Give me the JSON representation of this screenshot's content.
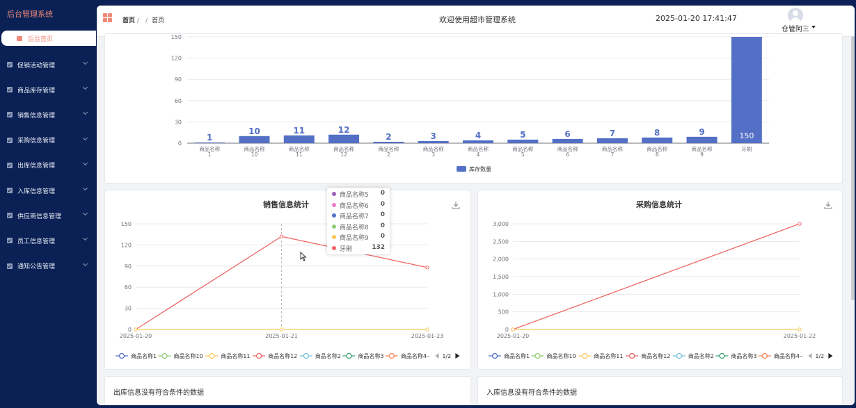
{
  "sidebar": {
    "logo": "后台管理系统",
    "active_item": "后台首页",
    "items": [
      {
        "label": "促销活动管理"
      },
      {
        "label": "商品库存管理"
      },
      {
        "label": "销售信息管理"
      },
      {
        "label": "采购信息管理"
      },
      {
        "label": "出库信息管理"
      },
      {
        "label": "入库信息管理"
      },
      {
        "label": "供应商信息管理"
      },
      {
        "label": "员工信息管理"
      },
      {
        "label": "通知公告管理"
      }
    ]
  },
  "header": {
    "breadcrumb_home": "首页",
    "breadcrumb_sep1": "/",
    "breadcrumb_sep2": "/",
    "breadcrumb_current": "首页",
    "title": "欢迎使用超市管理系统",
    "datetime": "2025-01-20 17:41:47",
    "user": "仓管阿三"
  },
  "colors": {
    "accent": "#f08a78",
    "bar": "#5470c6",
    "sidebar": "#0b2155"
  },
  "icons": [
    "grid-menu-icon",
    "home-icon",
    "checkbox-icon",
    "chevron-down-icon",
    "download-icon",
    "avatar-icon",
    "pointer-cursor-icon"
  ],
  "chart_data": [
    {
      "type": "bar",
      "title": "",
      "categories": [
        "商品名称\n1",
        "商品名称\n10",
        "商品名称\n11",
        "商品名称\n12",
        "商品名称\n2",
        "商品名称\n3",
        "商品名称\n4",
        "商品名称\n5",
        "商品名称\n6",
        "商品名称\n7",
        "商品名称\n8",
        "商品名称\n9",
        "牙刷"
      ],
      "series": [
        {
          "name": "库存数量",
          "values": [
            1,
            10,
            11,
            12,
            2,
            3,
            4,
            5,
            6,
            7,
            8,
            9,
            150
          ]
        }
      ],
      "yticks": [
        "0",
        "30",
        "60",
        "90",
        "120",
        "150"
      ],
      "ylim": [
        0,
        150
      ],
      "legend": "bottom-center",
      "grid": true
    },
    {
      "type": "line",
      "title": "销售信息统计",
      "x": [
        "2025-01-20",
        "2025-01-21",
        "2025-01-23"
      ],
      "yticks": [
        "0",
        "30",
        "60",
        "90",
        "120",
        "150"
      ],
      "ylim": [
        0,
        150
      ],
      "series": [
        {
          "name": "商品名称12",
          "values": [
            0,
            132,
            88
          ],
          "color": "#ee6666"
        },
        {
          "name": "商品名称11",
          "values": [
            0,
            0,
            0
          ],
          "color": "#fac858"
        }
      ],
      "legend_items": [
        {
          "name": "商品名称1",
          "color": "#5470c6"
        },
        {
          "name": "商品名称10",
          "color": "#91cc75"
        },
        {
          "name": "商品名称11",
          "color": "#fac858"
        },
        {
          "name": "商品名称12",
          "color": "#ee6666"
        },
        {
          "name": "商品名称2",
          "color": "#73c0de"
        },
        {
          "name": "商品名称3",
          "color": "#3ba272"
        },
        {
          "name": "商品名称4",
          "color": "#fc8452"
        }
      ],
      "legend_more": "–",
      "legend_page": "1/2",
      "tooltip": [
        {
          "name": "商品名称5",
          "value": "0",
          "color": "#9a60b4"
        },
        {
          "name": "商品名称6",
          "value": "0",
          "color": "#ea7ccc"
        },
        {
          "name": "商品名称7",
          "value": "0",
          "color": "#5470c6"
        },
        {
          "name": "商品名称8",
          "value": "0",
          "color": "#91cc75"
        },
        {
          "name": "商品名称9",
          "value": "0",
          "color": "#fac858"
        },
        {
          "name": "牙刷",
          "value": "132",
          "color": "#ee6666"
        }
      ],
      "grid": true
    },
    {
      "type": "line",
      "title": "采购信息统计",
      "x": [
        "2025-01-20",
        "2025-01-22"
      ],
      "yticks": [
        "0",
        "500",
        "1,000",
        "1,500",
        "2,000",
        "2,500",
        "3,000"
      ],
      "ylim": [
        0,
        3000
      ],
      "series": [
        {
          "name": "商品名称12",
          "values": [
            0,
            3000
          ],
          "color": "#ee6666"
        },
        {
          "name": "商品名称11",
          "values": [
            0,
            0
          ],
          "color": "#fac858"
        }
      ],
      "legend_items": [
        {
          "name": "商品名称1",
          "color": "#5470c6"
        },
        {
          "name": "商品名称10",
          "color": "#91cc75"
        },
        {
          "name": "商品名称11",
          "color": "#fac858"
        },
        {
          "name": "商品名称12",
          "color": "#ee6666"
        },
        {
          "name": "商品名称2",
          "color": "#73c0de"
        },
        {
          "name": "商品名称3",
          "color": "#3ba272"
        },
        {
          "name": "商品名称4",
          "color": "#fc8452"
        }
      ],
      "legend_more": "–",
      "legend_page": "1/2",
      "grid": true
    }
  ],
  "outbound": {
    "empty": "出库信息没有符合条件的数据"
  },
  "inbound": {
    "empty": "入库信息没有符合条件的数据"
  }
}
